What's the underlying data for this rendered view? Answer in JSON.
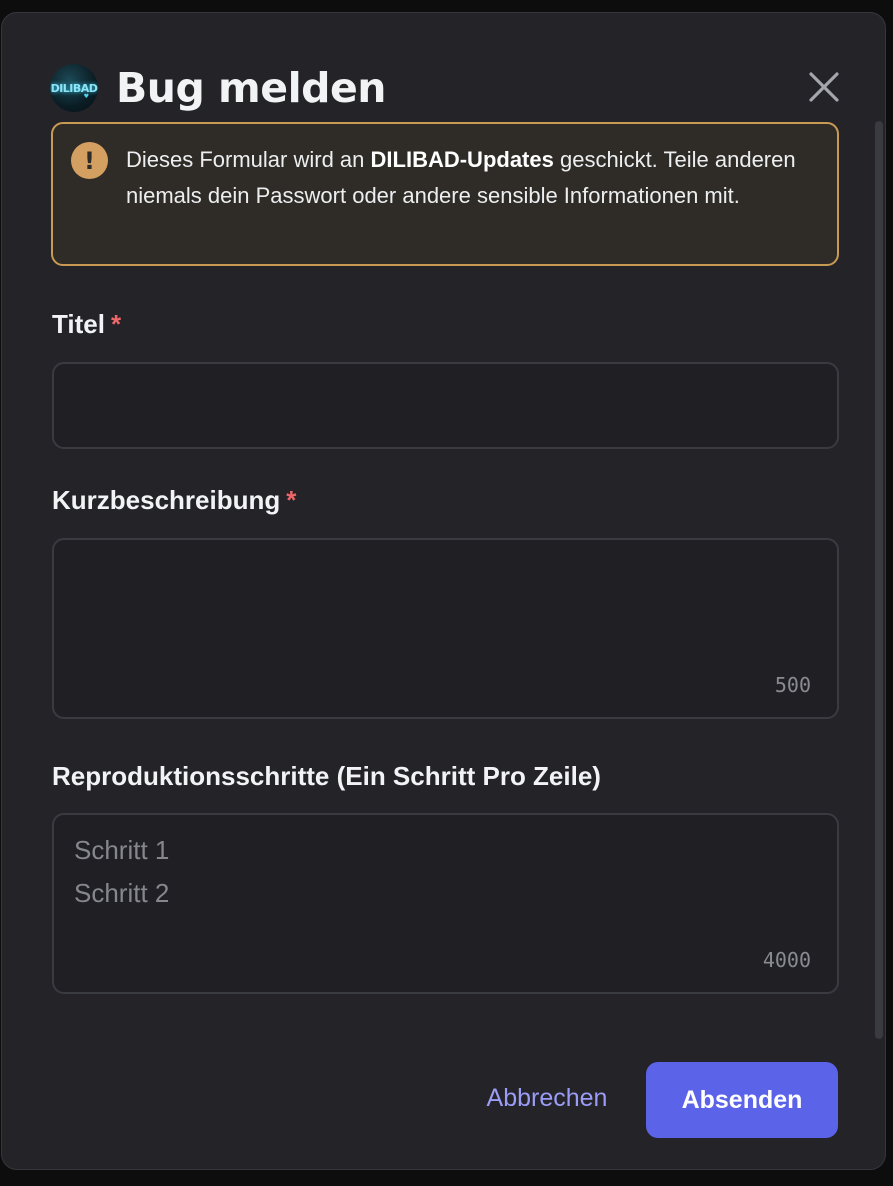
{
  "dialog": {
    "title": "Bug melden",
    "logo_text": "DILIBAD"
  },
  "notice": {
    "text_before": "Dieses Formular wird an ",
    "text_bold": "DILIBAD-Updates",
    "text_after": " geschickt. Teile anderen niemals dein Passwort oder andere sensible Informationen mit.",
    "icon": "exclamation-icon"
  },
  "fields": {
    "title_label": "Titel",
    "title_value": "",
    "summary_label": "Kurzbeschreibung",
    "summary_value": "",
    "summary_counter": "500",
    "steps_label": "Reproduktionsschritte (Ein Schritt Pro Zeile)",
    "steps_placeholder": "Schritt 1\nSchritt 2",
    "steps_counter": "4000",
    "required_marker": "*"
  },
  "actions": {
    "cancel_label": "Abbrechen",
    "submit_label": "Absenden"
  },
  "colors": {
    "accent": "#5b63e9",
    "warning_border": "#c99a54",
    "required": "#f0676a"
  }
}
